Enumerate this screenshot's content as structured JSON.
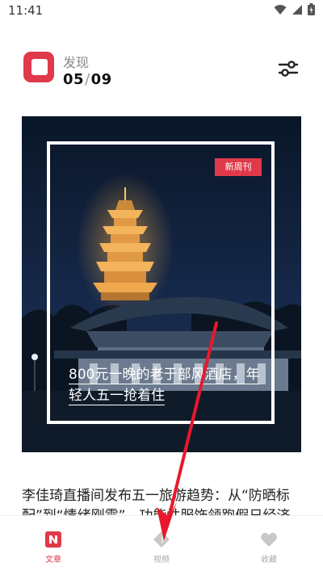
{
  "status_bar": {
    "time": "11:41"
  },
  "header": {
    "title": "发现",
    "date_current": "05",
    "date_total": "09",
    "filter_icon": "sliders-icon",
    "brand_color": "#e0394a"
  },
  "card": {
    "badge": "新周刊",
    "title": "800元一晚的老于部风酒店，年轻人五一抢着住",
    "badge_color": "#e0394a"
  },
  "article": {
    "text": "李佳琦直播间发布五一旅游趋势：从“防晒标配”到“情绪刚需”，功能性服饰领跑假日经济"
  },
  "tabs": [
    {
      "label": "文章",
      "icon": "article-icon",
      "active": true
    },
    {
      "label": "视频",
      "icon": "video-icon",
      "active": false
    },
    {
      "label": "收藏",
      "icon": "heart-icon",
      "active": false
    }
  ],
  "overlay": {
    "arrow_color": "#e8192c"
  }
}
